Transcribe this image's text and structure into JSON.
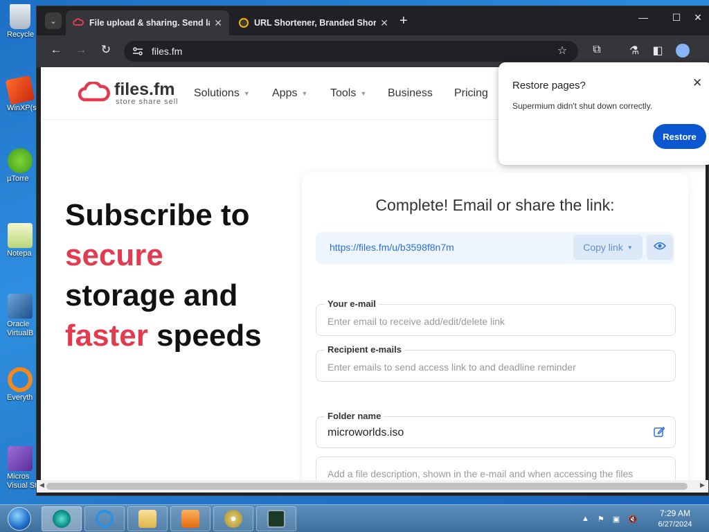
{
  "desktop": {
    "icons": [
      {
        "label": "Recycle",
        "icon": "recycle-bin-icon"
      },
      {
        "label": "WinXP(s",
        "icon": "winxp-icon"
      },
      {
        "label": "µTorre",
        "icon": "utorrent-icon"
      },
      {
        "label": "Notepa",
        "icon": "notepad-icon"
      },
      {
        "label": "Oracle\nVirtualB",
        "icon": "virtualbox-icon"
      },
      {
        "label": "Everyth",
        "icon": "everything-icon"
      },
      {
        "label": "Micros\nVisual St",
        "icon": "visual-studio-icon"
      }
    ]
  },
  "browser": {
    "tabs": [
      {
        "title": "File upload & sharing. Send lar",
        "active": true
      },
      {
        "title": "URL Shortener, Branded Short",
        "active": false
      }
    ],
    "address": "files.fm"
  },
  "site": {
    "logo_name": "files.fm",
    "logo_tagline": "store share sell",
    "nav": [
      {
        "label": "Solutions",
        "dropdown": true
      },
      {
        "label": "Apps",
        "dropdown": true
      },
      {
        "label": "Tools",
        "dropdown": true
      },
      {
        "label": "Business",
        "dropdown": false
      },
      {
        "label": "Pricing",
        "dropdown": false
      }
    ]
  },
  "hero": {
    "line1": "Subscribe to",
    "line2": "secure",
    "line3": "storage and",
    "line4_red": "faster",
    "line4_rest": " speeds"
  },
  "card": {
    "title": "Complete! Email or share the link:",
    "link_url": "https://files.fm/u/b3598f8n7m",
    "copy_label": "Copy link",
    "email": {
      "label": "Your e-mail",
      "placeholder": "Enter email to receive add/edit/delete link"
    },
    "recipients": {
      "label": "Recipient e-mails",
      "placeholder": "Enter emails to send access link to and deadline reminder"
    },
    "folder": {
      "label": "Folder name",
      "value": "microworlds.iso"
    },
    "description": {
      "placeholder": "Add a file description, shown in the e-mail and when accessing the files"
    }
  },
  "restore_popup": {
    "title": "Restore pages?",
    "message": "Supermium didn't shut down correctly.",
    "button": "Restore"
  },
  "taskbar": {
    "time": "7:29 AM",
    "date": "6/27/2024"
  },
  "colors": {
    "accent_red": "#e23a4f",
    "link_blue": "#2a6fd6",
    "restore_blue": "#0b57d0"
  }
}
